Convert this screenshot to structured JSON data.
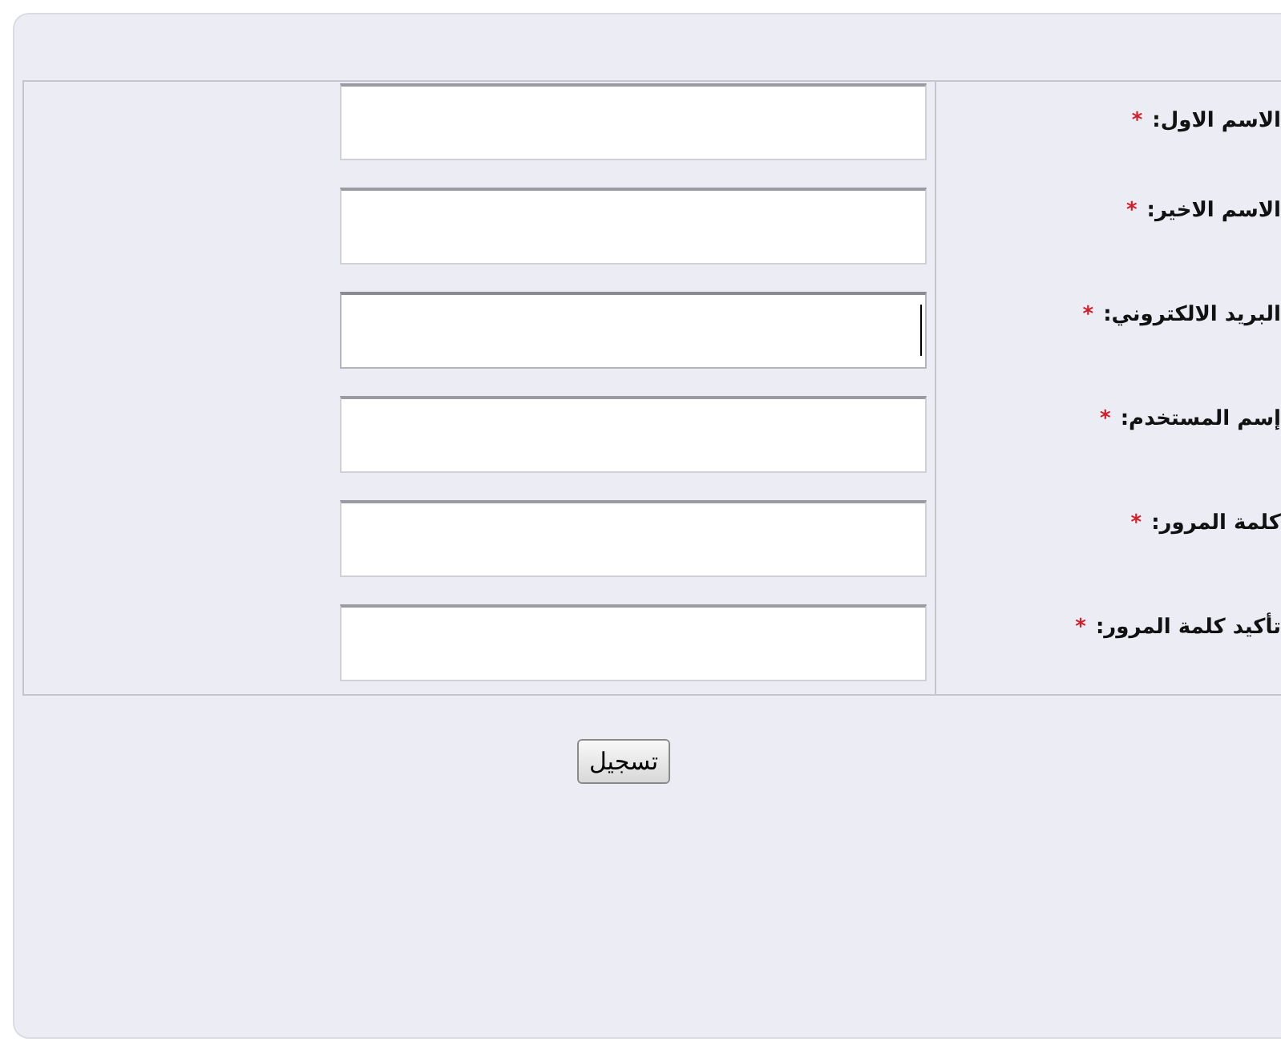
{
  "fields": [
    {
      "label": "الاسم الاول:",
      "required_mark": "*",
      "focused": false
    },
    {
      "label": "الاسم الاخير:",
      "required_mark": "*",
      "focused": false
    },
    {
      "label": "البريد الالكتروني:",
      "required_mark": "*",
      "focused": true
    },
    {
      "label": "إسم المستخدم:",
      "required_mark": "*",
      "focused": false
    },
    {
      "label": "كلمة المرور:",
      "required_mark": "*",
      "focused": false
    },
    {
      "label": "تأكيد كلمة المرور:",
      "required_mark": "*",
      "focused": false
    }
  ],
  "submit_button": "تسجيل"
}
